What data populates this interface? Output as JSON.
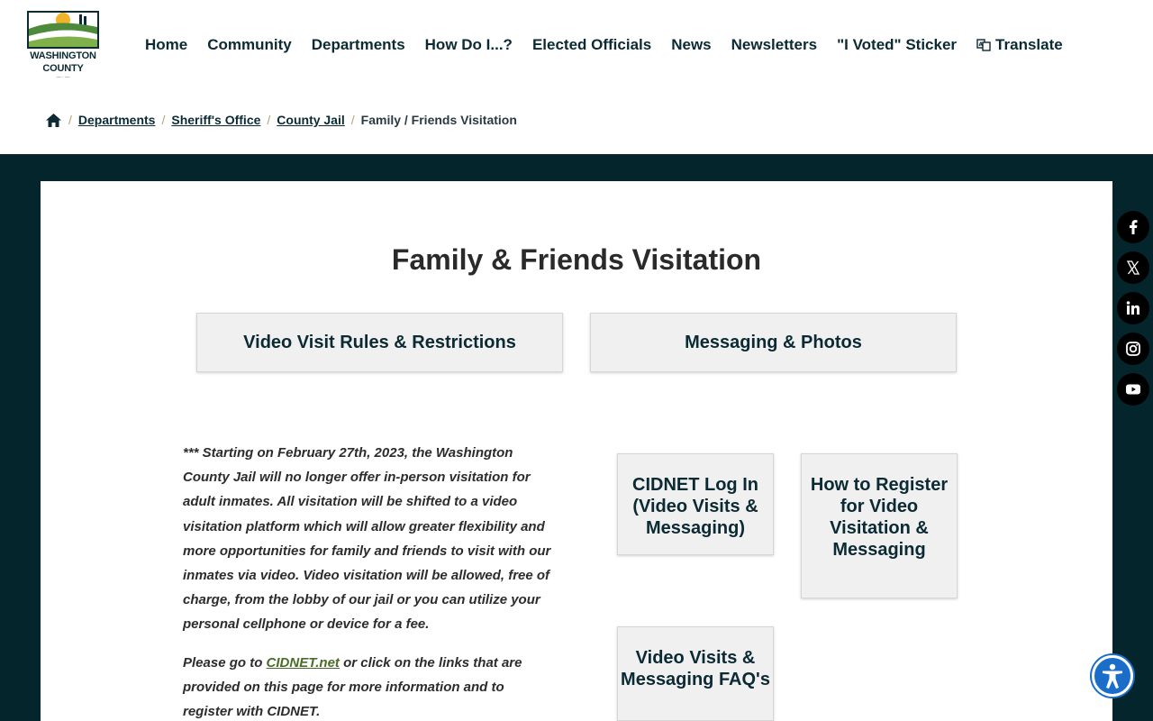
{
  "logo": {
    "line1": "WASHINGTON",
    "line2": "COUNTY"
  },
  "nav": {
    "items": [
      "Home",
      "Community",
      "Departments",
      "How Do I...?",
      "Elected Officials",
      "News",
      "Newsletters",
      "\"I Voted\" Sticker"
    ],
    "translate": "Translate"
  },
  "breadcrumb": {
    "links": [
      "Departments",
      "Sheriff's Office",
      "County Jail"
    ],
    "current": "Family / Friends Visitation",
    "separator": "/"
  },
  "page": {
    "title": "Family & Friends Visitation",
    "buttons": [
      "Video Visit Rules & Restrictions",
      "Messaging & Photos"
    ],
    "paragraph1": "*** Starting on February 27th, 2023, the Washington County Jail will no longer offer in-person visitation for adult inmates.  All visitation will be shifted to a video visitation platform which will allow greater flexibility and more opportunities for family and friends to visit with our inmates via video.  Video visitation will be allowed, free of charge, from the lobby of our jail or you can utilize your personal cellphone or device for a fee.",
    "paragraph2_pre": "Please go to ",
    "paragraph2_link": "CIDNET.net",
    "paragraph2_post": " or click on the links that are provided on this page for more information and to register with CIDNET.",
    "tiles": [
      "CIDNET Log In (Video Visits & Messaging)",
      "How to Register for Video Visitation & Messaging",
      "Video Visits & Messaging FAQ's"
    ]
  },
  "social": [
    "facebook-icon",
    "x-icon",
    "linkedin-icon",
    "instagram-icon",
    "youtube-icon"
  ],
  "colors": {
    "dark_band": "#05252d",
    "nav_text": "#0b2a33",
    "link_green": "#4a6b2a",
    "a11y_blue": "#1a6dc8"
  }
}
